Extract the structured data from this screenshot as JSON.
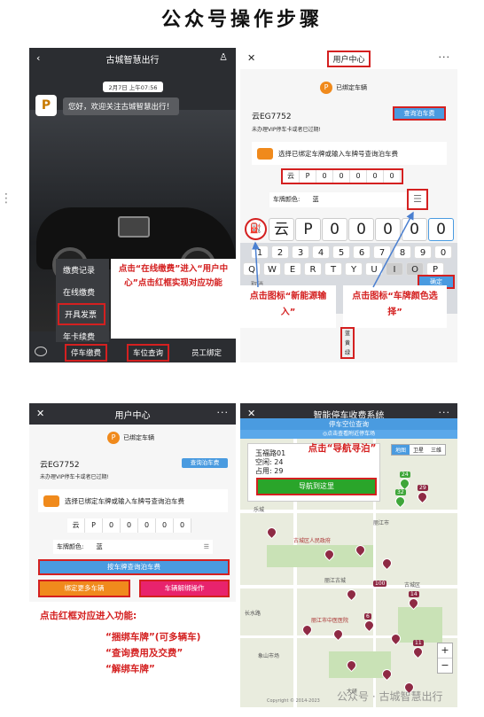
{
  "page_title": "公众号操作步骤",
  "side_dots": "⋮",
  "p1": {
    "title": "古城智慧出行",
    "back": "‹",
    "user": "♙",
    "time": "2月7日 上午07:56",
    "welcome": "您好，欢迎关注古城智慧出行！",
    "menu": [
      "缴费记录",
      "在线缴费",
      "开具发票",
      "年卡续费"
    ],
    "tabs": [
      "停车缴费",
      "车位查询",
      "员工绑定"
    ],
    "note": "点击“在线缴费”进入“用户中心”点击红框实现对应功能"
  },
  "p2": {
    "close": "✕",
    "title": "用户中心",
    "more": "···",
    "bound": "已绑定车辆",
    "plate": "云EG7752",
    "query_btn": "查询泊车费",
    "expired": "未办理VIP停车卡或者已过期!",
    "select_text": "选择已绑定车牌或输入车牌号查询泊车费",
    "plate_chars": [
      "云",
      "P",
      "0",
      "0",
      "0",
      "0",
      "0"
    ],
    "color_label": "车牌颜色:",
    "color_value": "蓝",
    "big_plate": [
      "云",
      "P",
      "0",
      "0",
      "0",
      "0",
      "0"
    ],
    "digits": [
      "1",
      "2",
      "3",
      "4",
      "5",
      "6",
      "7",
      "8",
      "9",
      "0"
    ],
    "letters": [
      "Q",
      "W",
      "E",
      "R",
      "T",
      "Y",
      "U",
      "I",
      "O",
      "P"
    ],
    "cancel": "取消",
    "confirm": "确定",
    "color_options": [
      "蓝",
      "黄",
      "绿"
    ],
    "note_left": "点击图标“新能源输入”",
    "note_right": "点击图标“车牌颜色选择”"
  },
  "p3": {
    "close": "✕",
    "title": "用户中心",
    "more": "···",
    "bound": "已绑定车辆",
    "plate": "云EG7752",
    "query_btn": "查询泊车费",
    "expired": "未办理VIP停车卡或者已过期!",
    "select_text": "选择已绑定车牌或输入车牌号查询泊车费",
    "plate_chars": [
      "云",
      "P",
      "0",
      "0",
      "0",
      "0",
      "0"
    ],
    "color_label": "车牌颜色:",
    "color_value": "蓝",
    "query_by_plate": "按车牌查询泊车费",
    "bind_more": "绑定更多车辆",
    "unbind": "车辆解绑操作",
    "note_title": "点击红框对应进入功能:",
    "note_items": [
      "“捆绑车牌”(可多辆车)",
      "“查询费用及交费”",
      "“解绑车牌”"
    ]
  },
  "p4": {
    "close": "✕",
    "title": "智能停车收费系统",
    "more": "···",
    "tab": "停车空位查询",
    "locate": "◎点击查看附近停车场",
    "map_types": [
      "地图",
      "卫星",
      "三维"
    ],
    "lot_name": "玉福路01",
    "free": "空闲: 24",
    "used": "占用: 29",
    "navigate": "导航到这里",
    "note": "点击“导航寻泊”",
    "place_labels": [
      "乐城",
      "古城区人民政府",
      "丽江古城",
      "长水路",
      "丽江市中医医院",
      "象山市场",
      "丽江市",
      "古城区",
      "大研"
    ],
    "numbers": [
      "24",
      "32",
      "29",
      "14",
      "6",
      "11",
      "100"
    ],
    "zoom_in": "+",
    "zoom_out": "−",
    "copyright": "Copyright © 2014-2023",
    "watermark": "公众号 · 古城智慧出行"
  },
  "colors": {
    "red": "#d42020",
    "orange": "#f08a1c",
    "blue": "#4a9be0",
    "green": "#2aa52a",
    "pink": "#e8236d"
  }
}
